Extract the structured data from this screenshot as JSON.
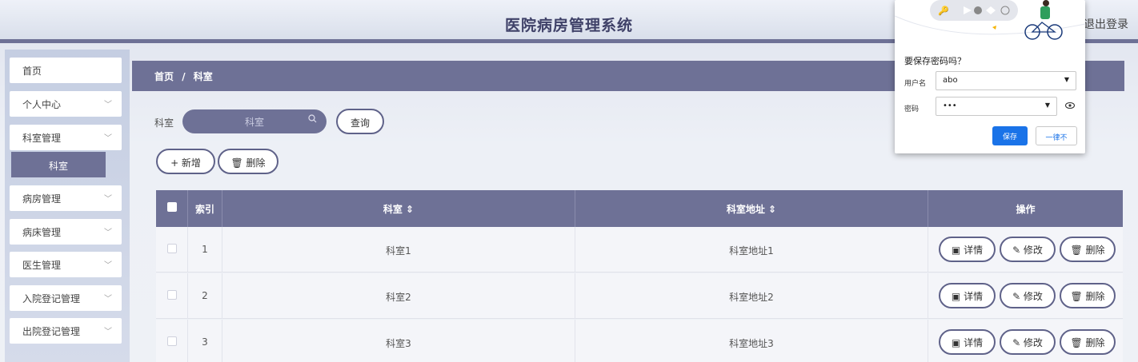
{
  "header": {
    "title": "医院病房管理系统",
    "logout_label": "退出登录"
  },
  "sidebar": {
    "items": [
      {
        "label": "首页",
        "has_chevron": false
      },
      {
        "label": "个人中心",
        "has_chevron": true
      },
      {
        "label": "科室管理",
        "has_chevron": true
      },
      {
        "label": "病房管理",
        "has_chevron": true
      },
      {
        "label": "病床管理",
        "has_chevron": true
      },
      {
        "label": "医生管理",
        "has_chevron": true
      },
      {
        "label": "入院登记管理",
        "has_chevron": true
      },
      {
        "label": "出院登记管理",
        "has_chevron": true
      }
    ],
    "subitem": {
      "label": "科室"
    },
    "chevron_glyph": "﹀"
  },
  "breadcrumb": {
    "home": "首页",
    "separator": "/",
    "current": "科室"
  },
  "search": {
    "label": "科室",
    "placeholder": "科室",
    "query_button": "查询"
  },
  "actions": {
    "add_label": "+ 新增",
    "delete_label": "🗑 删除"
  },
  "table": {
    "headers": {
      "index": "索引",
      "dept": "科室 ⇕",
      "address": "科室地址 ⇕",
      "ops": "操作"
    },
    "rows": [
      {
        "index": "1",
        "dept": "科室1",
        "address": "科室地址1"
      },
      {
        "index": "2",
        "dept": "科室2",
        "address": "科室地址2"
      },
      {
        "index": "3",
        "dept": "科室3",
        "address": "科室地址3"
      }
    ],
    "ops": {
      "detail": "▣ 详情",
      "edit": "✎ 修改",
      "delete": "🗑 删除"
    }
  },
  "password_popup": {
    "title": "要保存密码吗？",
    "username_label": "用户名",
    "username_value": "abo",
    "password_label": "密码",
    "password_value": "•••",
    "save_label": "保存",
    "never_label": "一律不"
  },
  "colors": {
    "accent": "#6e7196",
    "save_blue": "#1a73e8"
  }
}
